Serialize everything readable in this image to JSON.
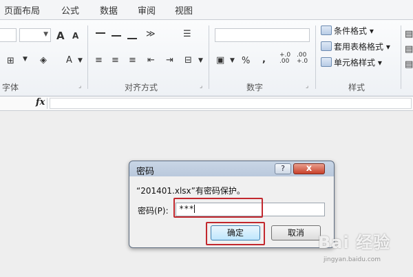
{
  "menu": {
    "tabs": [
      "页面布局",
      "公式",
      "数据",
      "审阅",
      "视图"
    ]
  },
  "ribbon": {
    "font_group": {
      "label": "字体",
      "grow_font": "A",
      "shrink_font": "A",
      "font_color": "A"
    },
    "alignment_group": {
      "label": "对齐方式"
    },
    "number_group": {
      "label": "数字",
      "percent": "%",
      "comma": ",",
      "increase_decimal": "+.0\n.00",
      "decrease_decimal": ".00\n+.0"
    },
    "styles_group": {
      "label": "样式",
      "conditional_format": "条件格式",
      "format_as_table": "套用表格格式",
      "cell_styles": "单元格样式"
    }
  },
  "formula_bar": {
    "fx": "fx",
    "value": ""
  },
  "dialog": {
    "title": "密码",
    "help": "?",
    "close": "x",
    "message": "“201401.xlsx”有密码保护。",
    "password_label": "密码(P):",
    "password_value": "***",
    "ok": "确定",
    "cancel": "取消"
  },
  "watermark": {
    "brand": "Bai 经验",
    "url": "jingyan.baidu.com"
  },
  "colors": {
    "highlight": "#c2272d",
    "close_button": "#c8402a"
  }
}
